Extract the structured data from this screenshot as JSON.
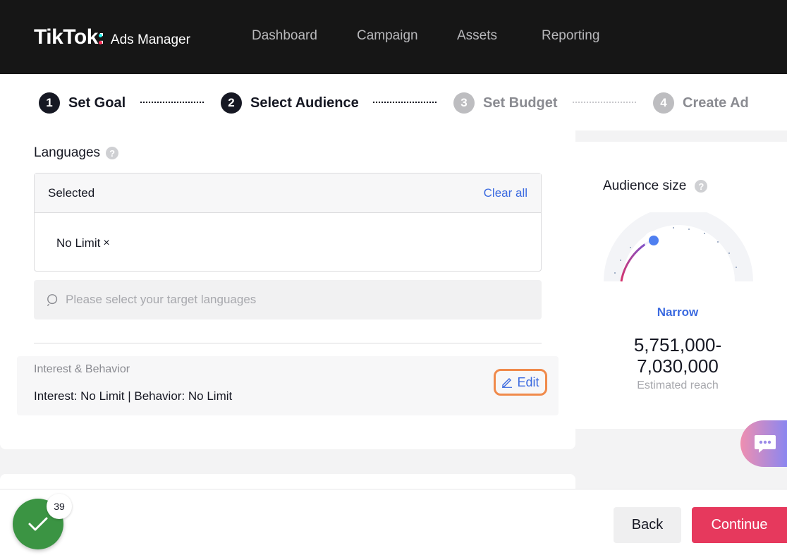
{
  "header": {
    "logo_main": "TikTok",
    "logo_colon": ":",
    "logo_sub": "Ads Manager",
    "nav": [
      "Dashboard",
      "Campaign",
      "Assets",
      "Reporting"
    ]
  },
  "steps": [
    {
      "num": "1",
      "label": "Set Goal",
      "state": "active"
    },
    {
      "num": "2",
      "label": "Select Audience",
      "state": "active"
    },
    {
      "num": "3",
      "label": "Set Budget",
      "state": "inactive"
    },
    {
      "num": "4",
      "label": "Create Ad",
      "state": "inactive"
    }
  ],
  "languages": {
    "label": "Languages",
    "help": "?",
    "selected_title": "Selected",
    "clear_all": "Clear all",
    "tag": "No Limit",
    "tag_remove": "×",
    "search_placeholder": "Please select your target languages"
  },
  "interest_behavior": {
    "title": "Interest & Behavior",
    "summary": "Interest: No Limit | Behavior: No Limit",
    "edit_label": "Edit"
  },
  "audience": {
    "title": "Audience size",
    "help": "?",
    "level": "Narrow",
    "reach_line1": "5,751,000-",
    "reach_line2": "7,030,000",
    "reach_label": "Estimated reach"
  },
  "footer": {
    "tasks_count": "39",
    "back_label": "Back",
    "continue_label": "Continue"
  },
  "colors": {
    "accent_blue": "#3b6ae0",
    "brand_red": "#e6395d",
    "header_bg": "#161616",
    "success_green": "#3b9443",
    "edit_highlight": "#f08a4b"
  },
  "icons": [
    "search-icon",
    "pencil-icon",
    "chat-icon",
    "check-icon",
    "help-icon",
    "close-icon"
  ]
}
